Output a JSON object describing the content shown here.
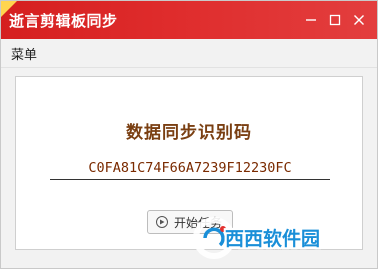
{
  "window": {
    "title": "逝言剪辑板同步",
    "controls": [
      "minimize-icon",
      "maximize-icon",
      "close-icon"
    ]
  },
  "menu": {
    "items": [
      {
        "label": "菜单"
      }
    ]
  },
  "panel": {
    "heading": "数据同步识别码",
    "code_value": "C0FA81C74F66A7239F12230FC",
    "start_button_label": "开始任务"
  },
  "watermark": {
    "text": "西西软件园"
  },
  "colors": {
    "titlebar": "#df2c2c",
    "heading": "#7a3f12",
    "code_text": "#7a2a00",
    "watermark_blue": "#1a8fd8"
  }
}
